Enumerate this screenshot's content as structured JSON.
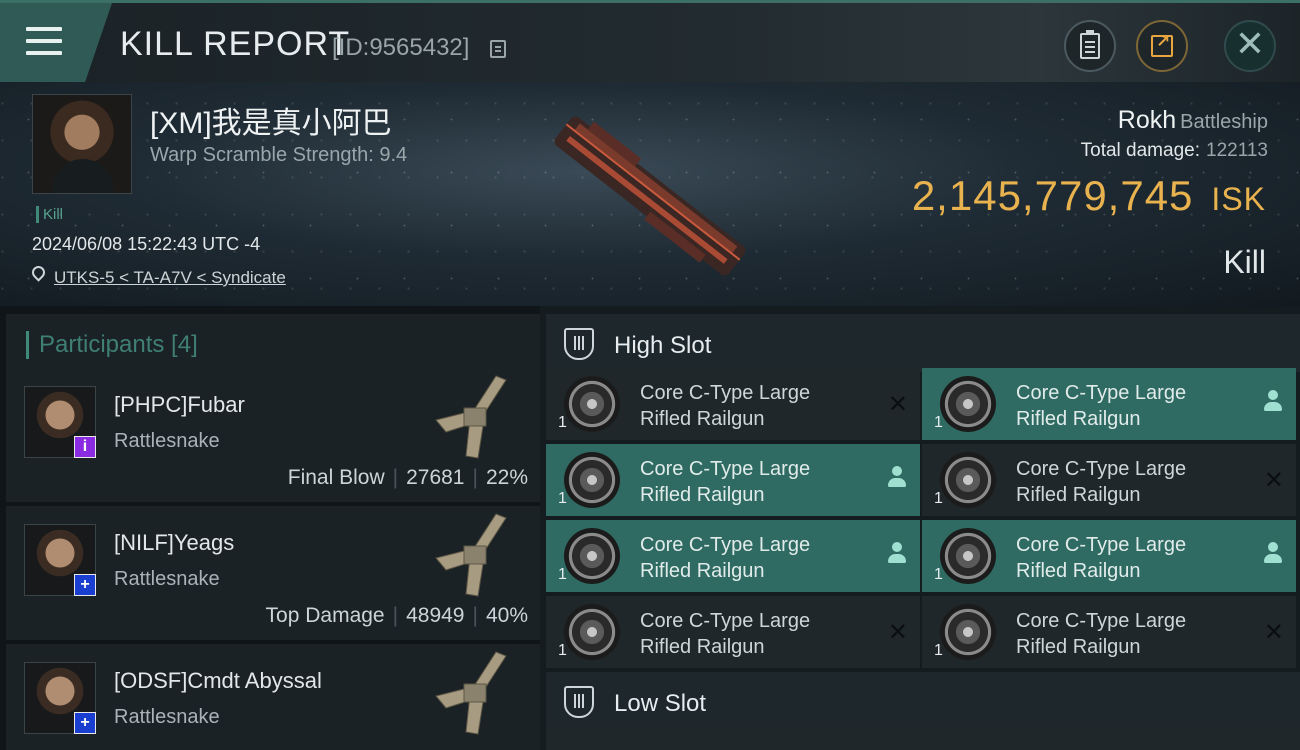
{
  "header": {
    "title": "KILL REPORT",
    "report_id": "[ID:9565432]"
  },
  "victim": {
    "name": "[XM]我是真小阿巴",
    "warp_scramble": "Warp Scramble Strength: 9.4",
    "kill_tag": "Kill",
    "datetime": "2024/06/08 15:22:43 UTC -4",
    "location": "UTKS-5 < TA-A7V < Syndicate"
  },
  "ship": {
    "name": "Rokh",
    "class": "Battleship",
    "total_damage_label": "Total damage:",
    "total_damage": "122113",
    "isk_value": "2,145,779,745",
    "isk_unit": "ISK",
    "result": "Kill"
  },
  "participants": {
    "header": "Participants [4]",
    "items": [
      {
        "name": "[PHPC]Fubar",
        "ship": "Rattlesnake",
        "role": "Final Blow",
        "damage": "27681",
        "percent": "22%",
        "badge": "i",
        "badge_color": "#8a2be2"
      },
      {
        "name": "[NILF]Yeags",
        "ship": "Rattlesnake",
        "role": "Top Damage",
        "damage": "48949",
        "percent": "40%",
        "badge": "+",
        "badge_color": "#1a3fd0"
      },
      {
        "name": "[ODSF]Cmdt Abyssal",
        "ship": "Rattlesnake",
        "role": "",
        "damage": "",
        "percent": "",
        "badge": "+",
        "badge_color": "#1a3fd0"
      }
    ]
  },
  "slots": {
    "high": {
      "title": "High Slot",
      "modules": [
        {
          "name": "Core C-Type Large Rifled Railgun",
          "qty": "1",
          "state": "destroyed"
        },
        {
          "name": "Core C-Type Large Rifled Railgun",
          "qty": "1",
          "state": "dropped"
        },
        {
          "name": "Core C-Type Large Rifled Railgun",
          "qty": "1",
          "state": "dropped"
        },
        {
          "name": "Core C-Type Large Rifled Railgun",
          "qty": "1",
          "state": "destroyed"
        },
        {
          "name": "Core C-Type Large Rifled Railgun",
          "qty": "1",
          "state": "dropped"
        },
        {
          "name": "Core C-Type Large Rifled Railgun",
          "qty": "1",
          "state": "dropped"
        },
        {
          "name": "Core C-Type Large Rifled Railgun",
          "qty": "1",
          "state": "destroyed"
        },
        {
          "name": "Core C-Type Large Rifled Railgun",
          "qty": "1",
          "state": "destroyed"
        }
      ]
    },
    "low": {
      "title": "Low Slot"
    }
  },
  "icons": {
    "menu": "hamburger-icon",
    "copy": "copy-icon",
    "clipboard": "clipboard-icon",
    "share": "share-icon",
    "close": "close-icon",
    "location": "pin-icon",
    "slot": "slot-icon",
    "destroyed": "x-mark-icon",
    "dropped": "person-icon"
  },
  "colors": {
    "accent": "#2f6a63",
    "isk": "#e8b24e"
  }
}
